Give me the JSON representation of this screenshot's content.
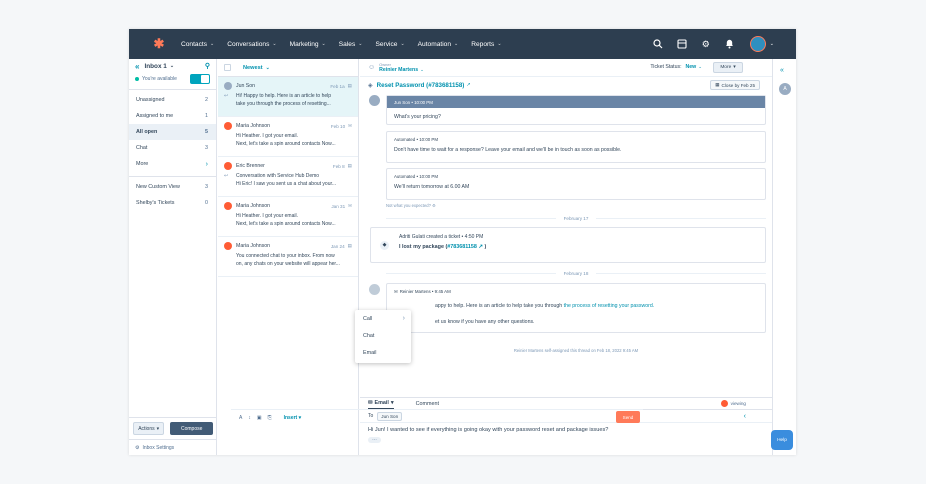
{
  "nav": {
    "items": [
      "Contacts",
      "Conversations",
      "Marketing",
      "Sales",
      "Service",
      "Automation",
      "Reports"
    ]
  },
  "sidebar": {
    "inbox_title": "Inbox 1",
    "availability": "You're available",
    "items": [
      {
        "label": "Unassigned",
        "count": "2"
      },
      {
        "label": "Assigned to me",
        "count": "1"
      },
      {
        "label": "All open",
        "count": "5"
      },
      {
        "label": "Chat",
        "count": "3"
      },
      {
        "label": "More",
        "count": ""
      },
      {
        "label": "New Custom View",
        "count": "3"
      },
      {
        "label": "Shelby's Tickets",
        "count": "0"
      }
    ],
    "actions_label": "Actions",
    "compose_label": "Compose",
    "settings_label": "Inbox Settings"
  },
  "list": {
    "sort_label": "Newest",
    "conversations": [
      {
        "name": "Jun Son",
        "date": "Feb 1a",
        "line1": "Hi! Happy to help. Here is an article to help",
        "line2": "take you through the process of resetting..."
      },
      {
        "name": "Maria Johnson",
        "date": "Feb 10",
        "line1": "Hi Heather. I got your email.",
        "line2": "Next, let's take a spin around contacts Now..."
      },
      {
        "name": "Eric Brenner",
        "date": "Feb 8",
        "line1": "Conversation with Service Hub Demo",
        "line2": "Hi Eric! I saw you sent us a chat about your..."
      },
      {
        "name": "Maria Johnson",
        "date": "Jan 31",
        "line1": "Hi Heather. I got your email.",
        "line2": "Next, let's take a spin around contacts Now..."
      },
      {
        "name": "Maria Johnson",
        "date": "Jan 24",
        "line1": "You connected chat to your inbox. From now",
        "line2": "on, any chats on your website will appear her..."
      }
    ]
  },
  "main": {
    "owner_label": "Owner",
    "owner_name": "Reinier Martens",
    "ticket_status_label": "Ticket Status:",
    "ticket_status_value": "New",
    "more_label": "More",
    "ticket_title": "Reset Password (#783681158)",
    "close_by": "Close by Feb 25",
    "messages": [
      {
        "header": "Jun Son  •  10:00 PM",
        "body": "What's your pricing?"
      },
      {
        "header": "Automated  •  10:00 PM",
        "body": "Don't have time to wait for a response? Leave your email and we'll be in touch as soon as possible."
      },
      {
        "header": "Automated  •  10:00 PM",
        "body": "We'll return tomorrow at 6.00 AM"
      }
    ],
    "not_expected": "Not what you expected?",
    "date_sep_1": "February 17",
    "ticket_created": "Adriti Gulati created a ticket  •  4:50 PM",
    "ticket_created_body": "I lost my package (",
    "ticket_created_link": "#783681158",
    "date_sep_2": "February 18",
    "agent_header": "Reinier Martens  •  9:45 AM",
    "agent_line1_pre": "appy to help. Here is an article to help take you through ",
    "agent_line1_link": "the process of resetting your password.",
    "agent_line2": "et us know if you have any other questions.",
    "assigned_note": "Reinier Martens self-assigned this thread on Feb 18, 2022 9:45 AM"
  },
  "composer": {
    "tab_email": "Email",
    "tab_comment": "Comment",
    "viewing": "viewing",
    "to_label": "To",
    "to_chip": "Jun Son",
    "body": "Hi Jun! I wanted to see if everything is going okay with your password reset and package issues?",
    "insert_label": "Insert",
    "send_label": "Send"
  },
  "dropdown": {
    "items": [
      "Call",
      "Chat",
      "Email"
    ]
  },
  "rightrail": {
    "avatar": "A"
  },
  "help_label": "Help"
}
